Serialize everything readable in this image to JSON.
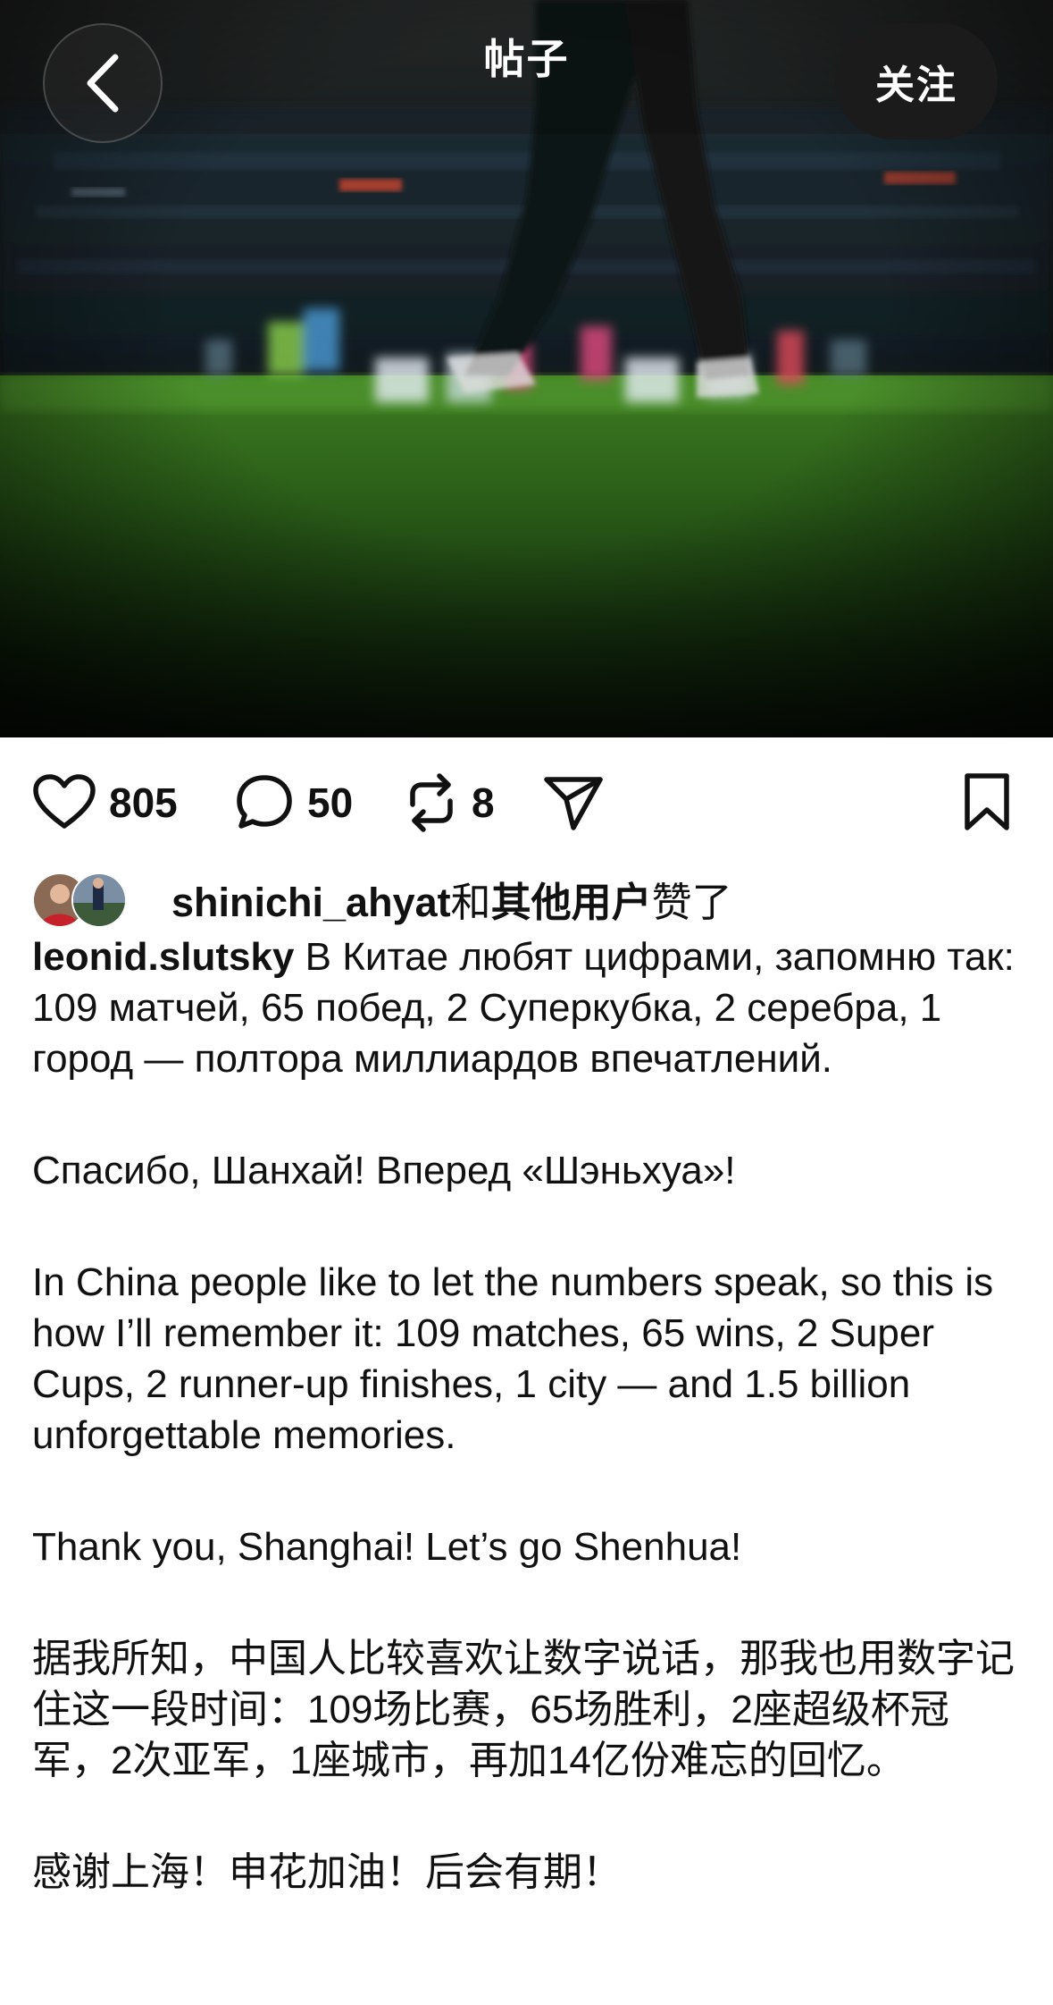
{
  "header": {
    "title": "帖子",
    "follow_label": "关注"
  },
  "actions": {
    "likes": "805",
    "comments": "50",
    "reposts": "8"
  },
  "liked_by": {
    "user": "shinichi_ahyat",
    "connector": "和",
    "others": "其他用户",
    "suffix": "赞了"
  },
  "post": {
    "author": "leonid.slutsky",
    "paragraphs": [
      "В Китае любят цифрами, запомню так: 109 матчей, 65 побед, 2 Суперкубка, 2 серебра, 1 город — полтора миллиардов впечатлений.",
      "Спасибо, Шанхай! Вперед «Шэньхуа»!",
      "In China people like to let the numbers speak, so this is how I’ll remember it: 109 matches, 65 wins, 2 Super Cups, 2 runner-up finishes, 1 city — and 1.5 billion unforgettable memories.",
      "Thank you, Shanghai! Let’s go Shenhua!",
      "据我所知，中国人比较喜欢让数字说话，那我也用数字记住这一段时间：109场比赛，65场胜利，2座超级杯冠军，2次亚军，1座城市，再加14亿份难忘的回忆。",
      "感谢上海！申花加油！后会有期！"
    ]
  },
  "icons": {
    "back": "chevron-left-icon",
    "like": "heart-icon",
    "comment": "comment-bubble-icon",
    "repost": "repost-icon",
    "share": "send-icon",
    "save": "bookmark-icon"
  },
  "colors": {
    "text": "#111111",
    "pitch_green": "#2f6b1e",
    "follow_bg": "#1b1b1b"
  }
}
